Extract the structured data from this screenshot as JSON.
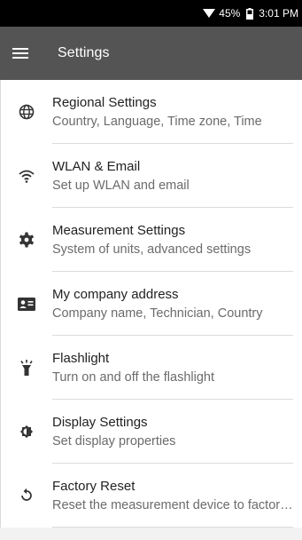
{
  "status_bar": {
    "battery_percent": "45%",
    "time": "3:01 PM",
    "icons": [
      "wifi-icon",
      "battery-icon"
    ]
  },
  "app_bar": {
    "title": "Settings",
    "menu_icon": "hamburger-menu-icon"
  },
  "items": [
    {
      "icon": "globe-icon",
      "title": "Regional Settings",
      "subtitle": "Country, Language, Time zone, Time"
    },
    {
      "icon": "wifi-icon",
      "title": "WLAN & Email",
      "subtitle": "Set up WLAN and email"
    },
    {
      "icon": "gear-icon",
      "title": "Measurement Settings",
      "subtitle": "System of units, advanced settings"
    },
    {
      "icon": "contact-card-icon",
      "title": "My company address",
      "subtitle": "Company name, Technician, Country"
    },
    {
      "icon": "flashlight-icon",
      "title": "Flashlight",
      "subtitle": "Turn on and off the flashlight"
    },
    {
      "icon": "brightness-icon",
      "title": "Display Settings",
      "subtitle": "Set display properties"
    },
    {
      "icon": "reset-icon",
      "title": "Factory Reset",
      "subtitle": "Reset the measurement device to factory settings"
    }
  ]
}
